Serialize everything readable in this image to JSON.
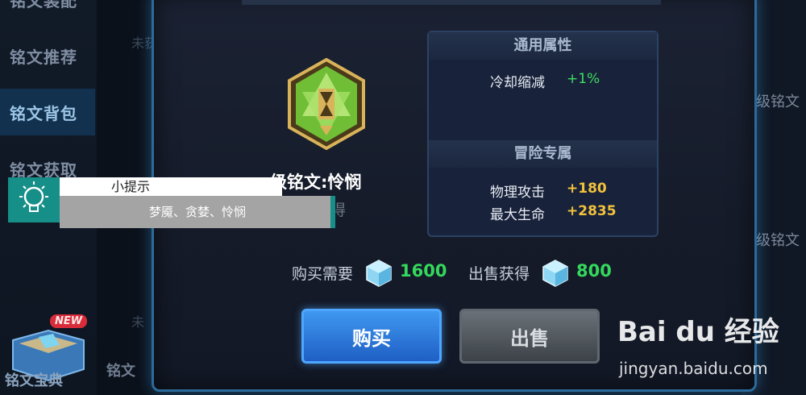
{
  "sidebar": {
    "items": [
      {
        "label": "铭文装配"
      },
      {
        "label": "铭文推荐"
      },
      {
        "label": "铭文背包"
      },
      {
        "label": "铭文获取"
      }
    ],
    "bottom_label": "铭文宝典",
    "new_badge": "NEW"
  },
  "background": {
    "dim_texts": [
      "未获",
      "未",
      "铭文"
    ],
    "right_texts": [
      "级铭文",
      "级铭文"
    ]
  },
  "dialog": {
    "rune_name": "级铭文:怜悯",
    "rune_status": "未获得",
    "general_header": "通用属性",
    "general_props": [
      {
        "label": "冷却缩减",
        "value": "+1%"
      }
    ],
    "adventure_header": "冒险专属",
    "adventure_props": [
      {
        "label": "物理攻击",
        "value": "+180"
      },
      {
        "label": "最大生命",
        "value": "+2835"
      }
    ],
    "buy_price_label": "购买需要",
    "buy_price": "1600",
    "sell_price_label": "出售获得",
    "sell_price": "800",
    "buy_button": "购买",
    "sell_button": "出售"
  },
  "tip": {
    "title": "小提示",
    "body": "梦魇、贪婪、怜悯"
  },
  "watermark": {
    "logo": "Bai du 经验",
    "url": "jingyan.baidu.com"
  },
  "colors": {
    "accent_blue": "#2b6a9a",
    "green_value": "#3fdc63",
    "gold_value": "#f2c23d",
    "tip_teal": "#168f88"
  }
}
